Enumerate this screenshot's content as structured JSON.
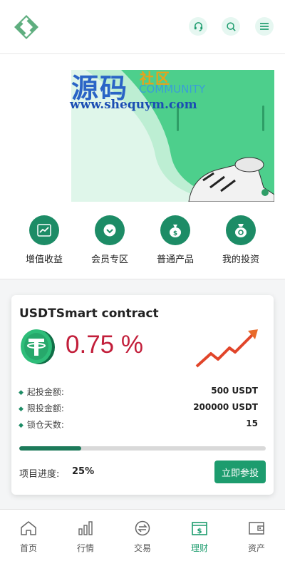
{
  "header": {
    "logo_icon": "diamond-s-logo",
    "support_icon": "headset-icon",
    "search_icon": "search-icon",
    "menu_icon": "hamburger-menu-icon",
    "accent": "#1d9c6e"
  },
  "banner": {
    "watermark_cn": "源码",
    "watermark_she": "社区",
    "watermark_en": "COMMUNITY",
    "watermark_url": "www.shequym.com",
    "background": "#4dcf8c"
  },
  "menu": {
    "items": [
      {
        "label": "增值收益",
        "icon": "trend-chart-icon"
      },
      {
        "label": "会员专区",
        "icon": "member-badge-icon"
      },
      {
        "label": "普通产品",
        "icon": "money-bag-icon"
      },
      {
        "label": "我的投资",
        "icon": "investment-bag-icon"
      }
    ]
  },
  "product": {
    "title": "USDTSmart contract",
    "rate": "0.75 %",
    "rows": [
      {
        "label": "起投金额:",
        "value": "500 USDT"
      },
      {
        "label": "限投金额:",
        "value": "200000 USDT"
      },
      {
        "label": "锁仓天数:",
        "value": "15"
      }
    ],
    "progress_label": "项目进度:",
    "progress_value": "25%",
    "progress_fraction": 0.25,
    "invest_button": "立即参投",
    "coin_icon": "tether-coin-icon",
    "trend_icon": "rising-arrow-icon"
  },
  "nav": {
    "items": [
      {
        "label": "首页",
        "icon": "home-icon",
        "active": false
      },
      {
        "label": "行情",
        "icon": "bar-chart-icon",
        "active": false
      },
      {
        "label": "交易",
        "icon": "exchange-icon",
        "active": false
      },
      {
        "label": "理财",
        "icon": "finance-icon",
        "active": true
      },
      {
        "label": "资产",
        "icon": "wallet-icon",
        "active": false
      }
    ]
  }
}
